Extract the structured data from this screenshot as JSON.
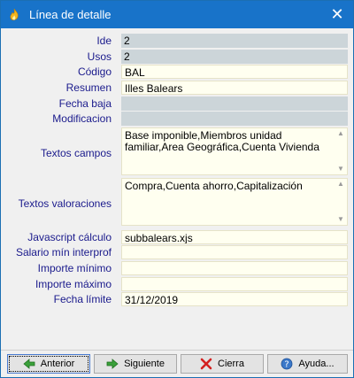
{
  "window": {
    "title": "Línea de detalle",
    "close_symbol": "✕"
  },
  "fields": {
    "ide": {
      "label": "Ide",
      "value": "2"
    },
    "usos": {
      "label": "Usos",
      "value": "2"
    },
    "codigo": {
      "label": "Código",
      "value": "BAL"
    },
    "resumen": {
      "label": "Resumen",
      "value": "Illes Balears"
    },
    "fecha_baja": {
      "label": "Fecha baja",
      "value": ""
    },
    "modificacion": {
      "label": "Modificacion",
      "value": ""
    },
    "textos_campos": {
      "label": "Textos campos",
      "value": "Base imponible,Miembros unidad familiar,Area Geográfica,Cuenta Vivienda"
    },
    "textos_valoraciones": {
      "label": "Textos valoraciones",
      "value": "Compra,Cuenta ahorro,Capitalización"
    },
    "javascript_calculo": {
      "label": "Javascript cálculo",
      "value": "subbalears.xjs"
    },
    "salario_min": {
      "label": "Salario mín interprof",
      "value": ""
    },
    "importe_minimo": {
      "label": "Importe mínimo",
      "value": ""
    },
    "importe_maximo": {
      "label": "Importe máximo",
      "value": ""
    },
    "fecha_limite": {
      "label": "Fecha límite",
      "value": "31/12/2019"
    }
  },
  "buttons": {
    "anterior": "Anterior",
    "siguiente": "Siguiente",
    "cierra": "Cierra",
    "ayuda": "Ayuda..."
  },
  "icons": {
    "title": "flame-icon",
    "anterior": "arrow-left-icon",
    "siguiente": "arrow-right-icon",
    "cierra": "red-x-icon",
    "ayuda": "help-icon"
  },
  "colors": {
    "titlebar": "#1873c9",
    "label_text": "#1a1a8c",
    "readonly_field": "#ccd5d9",
    "editable_field": "#fffff0"
  }
}
